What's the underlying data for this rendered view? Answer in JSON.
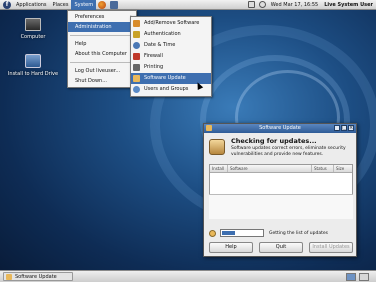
{
  "top_panel": {
    "menus": [
      "Applications",
      "Places",
      "System"
    ],
    "clock": "Wed Mar 17, 16:55",
    "user": "Live System User"
  },
  "desktop": {
    "icons": [
      {
        "label": "Computer",
        "icon": "computer-icon"
      },
      {
        "label": "Install to Hard Drive",
        "icon": "hard-drive-icon"
      }
    ]
  },
  "system_menu": {
    "items": [
      "Preferences",
      "Administration",
      "Help",
      "About this Computer",
      "Log Out liveuser...",
      "Shut Down..."
    ]
  },
  "admin_menu": {
    "items": [
      {
        "label": "Add/Remove Software",
        "icon": "package-icon",
        "color": "#d98c2b"
      },
      {
        "label": "Authentication",
        "icon": "key-icon",
        "color": "#c9a227"
      },
      {
        "label": "Date & Time",
        "icon": "clock-icon",
        "color": "#4a78b5"
      },
      {
        "label": "Firewall",
        "icon": "firewall-icon",
        "color": "#c0392b"
      },
      {
        "label": "Printing",
        "icon": "printer-icon",
        "color": "#666666"
      },
      {
        "label": "Software Update",
        "icon": "software-update-icon",
        "color": "#e9b85a"
      },
      {
        "label": "Users and Groups",
        "icon": "users-icon",
        "color": "#5a8ac6"
      }
    ]
  },
  "update_window": {
    "title": "Software Update",
    "heading": "Checking for updates...",
    "description": "Software updates correct errors, eliminate security vulnerabilities and provide new features.",
    "columns": [
      "Install",
      "Software",
      "Status",
      "Size"
    ],
    "status_text": "Getting the list of updates",
    "progress": 0.3,
    "buttons": {
      "help": "Help",
      "quit": "Quit",
      "install": "Install Updates"
    }
  },
  "taskbar": {
    "window_button": "Software Update"
  },
  "colors": {
    "selection": "#3e6fb0",
    "desktop": "#1d4e84"
  }
}
